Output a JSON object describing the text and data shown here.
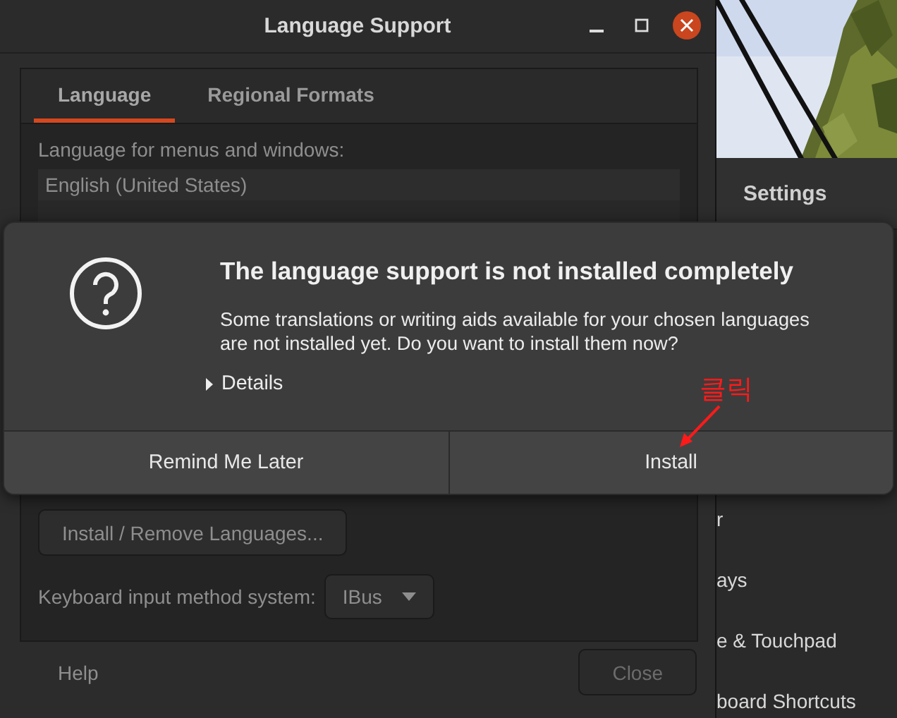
{
  "language_window": {
    "title": "Language Support",
    "tabs": [
      {
        "label": "Language",
        "selected": true
      },
      {
        "label": "Regional Formats",
        "selected": false
      }
    ],
    "languages_label": "Language for menus and windows:",
    "languages": [
      "English (United States)"
    ],
    "install_remove_button": "Install / Remove Languages...",
    "input_method_label": "Keyboard input method system:",
    "input_method": {
      "value": "IBus"
    },
    "help_button": "Help",
    "close_button": {
      "label": "Close",
      "disabled": true
    }
  },
  "settings_window": {
    "title": "Settings",
    "items": [
      "r",
      "ays",
      "e & Touchpad",
      "board Shortcuts"
    ]
  },
  "dialog": {
    "title": "The language support is not installed completely",
    "message": "Some translations or writing aids available for your chosen languages are not installed yet. Do you want to install them now?",
    "details": {
      "label": "Details",
      "expanded": false
    },
    "buttons": [
      {
        "label": "Remind Me Later"
      },
      {
        "label": "Install"
      }
    ]
  },
  "annotation": {
    "label": "클릭"
  }
}
